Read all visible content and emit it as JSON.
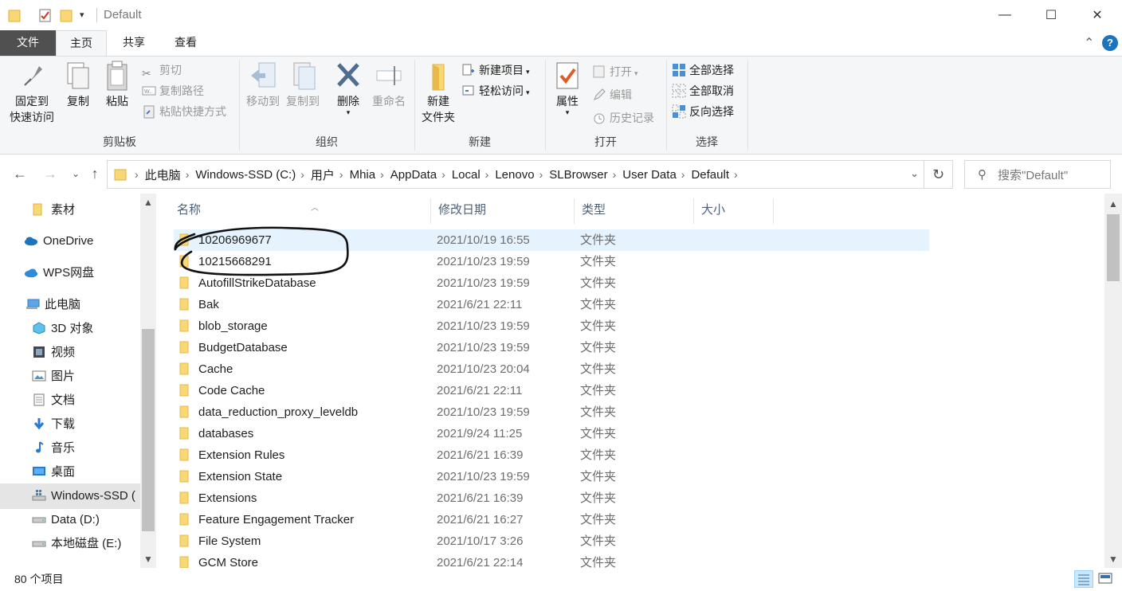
{
  "window": {
    "title": "Default",
    "minimize_glyph": "—",
    "maximize_glyph": "☐",
    "close_glyph": "✕",
    "quick_access_dropdown": "▾"
  },
  "ribbon_tabs": [
    {
      "label": "文件"
    },
    {
      "label": "主页"
    },
    {
      "label": "共享"
    },
    {
      "label": "查看"
    }
  ],
  "ribbon": {
    "collapse_glyph": "⌃",
    "help_glyph": "?",
    "clipboard": {
      "label": "剪贴板",
      "pin_line1": "固定到",
      "pin_line2": "快速访问",
      "copy": "复制",
      "paste": "粘贴",
      "cut": "剪切",
      "copy_path": "复制路径",
      "paste_shortcut": "粘贴快捷方式"
    },
    "organize": {
      "label": "组织",
      "move_to": "移动到",
      "copy_to": "复制到",
      "delete": "删除",
      "rename": "重命名"
    },
    "new": {
      "label": "新建",
      "new_folder_line1": "新建",
      "new_folder_line2": "文件夹",
      "new_item": "新建项目",
      "easy_access": "轻松访问"
    },
    "open": {
      "label": "打开",
      "properties": "属性",
      "open": "打开",
      "edit": "编辑",
      "history": "历史记录"
    },
    "select": {
      "label": "选择",
      "select_all": "全部选择",
      "select_none": "全部取消",
      "invert": "反向选择"
    }
  },
  "address_bar": {
    "crumbs": [
      "此电脑",
      "Windows-SSD (C:)",
      "用户",
      "Mhia",
      "AppData",
      "Local",
      "Lenovo",
      "SLBrowser",
      "User Data",
      "Default"
    ],
    "search_placeholder": "搜索\"Default\""
  },
  "nav_pane": {
    "items": [
      {
        "label": "素材",
        "icon": "folder-icon"
      },
      {
        "label": "OneDrive",
        "icon": "cloud-icon"
      },
      {
        "label": "WPS网盘",
        "icon": "cloud-icon"
      },
      {
        "label": "此电脑",
        "icon": "computer-icon"
      },
      {
        "label": "3D 对象",
        "icon": "cube-icon"
      },
      {
        "label": "视频",
        "icon": "film-icon"
      },
      {
        "label": "图片",
        "icon": "picture-icon"
      },
      {
        "label": "文档",
        "icon": "document-icon"
      },
      {
        "label": "下载",
        "icon": "download-icon"
      },
      {
        "label": "音乐",
        "icon": "music-icon"
      },
      {
        "label": "桌面",
        "icon": "desktop-icon"
      },
      {
        "label": "Windows-SSD (",
        "icon": "drive-icon"
      },
      {
        "label": "Data (D:)",
        "icon": "drive-icon"
      },
      {
        "label": "本地磁盘 (E:)",
        "icon": "drive-icon"
      }
    ]
  },
  "columns": {
    "name": "名称",
    "modified": "修改日期",
    "type": "类型",
    "size": "大小"
  },
  "files": [
    {
      "name": "10206969677",
      "modified": "2021/10/19 16:55",
      "type": "文件夹"
    },
    {
      "name": "10215668291",
      "modified": "2021/10/23 19:59",
      "type": "文件夹"
    },
    {
      "name": "AutofillStrikeDatabase",
      "modified": "2021/10/23 19:59",
      "type": "文件夹"
    },
    {
      "name": "Bak",
      "modified": "2021/6/21 22:11",
      "type": "文件夹"
    },
    {
      "name": "blob_storage",
      "modified": "2021/10/23 19:59",
      "type": "文件夹"
    },
    {
      "name": "BudgetDatabase",
      "modified": "2021/10/23 19:59",
      "type": "文件夹"
    },
    {
      "name": "Cache",
      "modified": "2021/10/23 20:04",
      "type": "文件夹"
    },
    {
      "name": "Code Cache",
      "modified": "2021/6/21 22:11",
      "type": "文件夹"
    },
    {
      "name": "data_reduction_proxy_leveldb",
      "modified": "2021/10/23 19:59",
      "type": "文件夹"
    },
    {
      "name": "databases",
      "modified": "2021/9/24 11:25",
      "type": "文件夹"
    },
    {
      "name": "Extension Rules",
      "modified": "2021/6/21 16:39",
      "type": "文件夹"
    },
    {
      "name": "Extension State",
      "modified": "2021/10/23 19:59",
      "type": "文件夹"
    },
    {
      "name": "Extensions",
      "modified": "2021/6/21 16:39",
      "type": "文件夹"
    },
    {
      "name": "Feature Engagement Tracker",
      "modified": "2021/6/21 16:27",
      "type": "文件夹"
    },
    {
      "name": "File System",
      "modified": "2021/10/17 3:26",
      "type": "文件夹"
    },
    {
      "name": "GCM Store",
      "modified": "2021/6/21 22:14",
      "type": "文件夹"
    }
  ],
  "status": {
    "item_count": "80 个项目"
  },
  "colors": {
    "folder": "#f8d775",
    "folder_dark": "#e8b84a",
    "selection": "#e5f3ff",
    "accent": "#1e73be"
  }
}
